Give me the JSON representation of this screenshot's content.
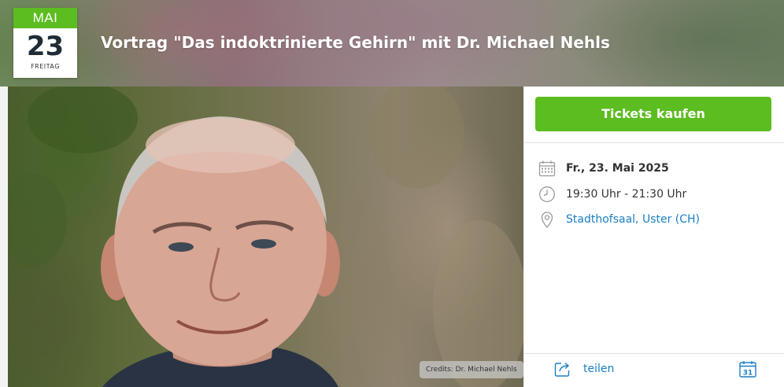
{
  "event": {
    "month": "MAI",
    "day": "23",
    "weekday": "FREITAG",
    "title": "Vortrag \"Das indoktrinierte Gehirn\" mit Dr. Michael Nehls"
  },
  "photo": {
    "credits": "Credits: Dr. Michael Nehls"
  },
  "sidebar": {
    "ticket_label": "Tickets kaufen",
    "date_text": "Fr., 23. Mai 2025",
    "time_text": "19:30 Uhr - 21:30 Uhr",
    "location_text": "Stadthofsaal, Uster (CH)",
    "share_label": "teilen",
    "calendar_icon_number": "31"
  },
  "icons": {
    "date": "calendar-icon",
    "time": "clock-icon",
    "location": "map-pin-icon",
    "share": "share-icon",
    "add_calendar": "add-to-calendar-icon"
  },
  "colors": {
    "accent_green": "#5cbd20",
    "link_blue": "#1a7fc3",
    "icon_blue": "#1a7fc3",
    "icon_gray": "#9a9a9a"
  }
}
